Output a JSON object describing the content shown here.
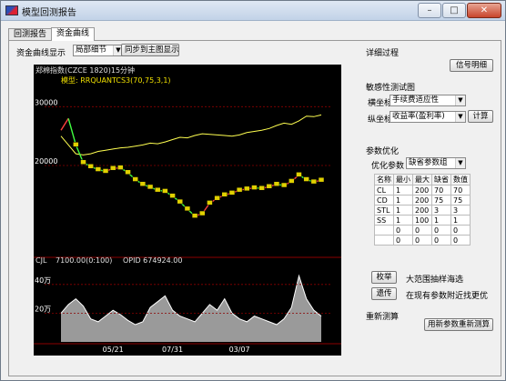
{
  "window": {
    "title": "模型回测报告"
  },
  "tabs": [
    {
      "label": "回测报告"
    },
    {
      "label": "资金曲线"
    }
  ],
  "toolbar": {
    "display_label": "资金曲线显示",
    "display_mode": "局部细节",
    "sync_button": "同步到主图显示"
  },
  "chart": {
    "header": "郑棉指数(CZCE 1820)15分钟",
    "model_label": "模型: RRQUANTCS3(70,75,3,1)",
    "y_ticks": [
      "30000",
      "20000"
    ],
    "volume_header_name": "CJL",
    "volume_header_value": "7100.00(0:100)",
    "volume_header_opid": "OPID 674924.00",
    "volume_ticks": [
      "40万",
      "20万"
    ],
    "x_ticks": [
      "05/21",
      "07/31",
      "03/07"
    ],
    "colors": {
      "equity": "#ffff50",
      "price_up": "#ff4040",
      "price_down": "#40ff40",
      "marker": "#e0d000",
      "volume": "#ffffff",
      "grid": "#8b0000"
    }
  },
  "chart_data": {
    "type": "line",
    "title": "郑棉指数(CZCE 1820)15分钟",
    "series": [
      {
        "name": "资金曲线",
        "values": [
          25000,
          23500,
          22000,
          21800,
          22000,
          22400,
          22600,
          22800,
          23000,
          23100,
          23300,
          23500,
          23800,
          23700,
          24000,
          24400,
          24800,
          24700,
          25100,
          25400,
          25300,
          25200,
          25100,
          25000,
          25200,
          25600,
          25800,
          26000,
          26300,
          26800,
          27200,
          27000,
          27600,
          28400,
          28300,
          28600
        ]
      },
      {
        "name": "价格",
        "values": [
          26000,
          28000,
          23500,
          20500,
          19800,
          19300,
          19000,
          19500,
          19600,
          18800,
          17600,
          16800,
          16300,
          15800,
          15600,
          14800,
          13800,
          12600,
          11400,
          11800,
          13600,
          14400,
          15000,
          15300,
          15800,
          16000,
          16200,
          16100,
          16400,
          16800,
          16600,
          17300,
          18400,
          17600,
          17200,
          17500
        ]
      }
    ],
    "ylim": [
      5000,
      35000
    ],
    "volume": [
      20,
      26,
      30,
      25,
      16,
      14,
      18,
      22,
      19,
      15,
      12,
      14,
      24,
      28,
      32,
      22,
      18,
      16,
      14,
      20,
      26,
      22,
      30,
      20,
      16,
      14,
      18,
      16,
      14,
      12,
      16,
      24,
      46,
      30,
      22,
      18
    ],
    "volume_unit": "万",
    "x_labels": [
      "05/21",
      "07/31",
      "03/07"
    ]
  },
  "right": {
    "details_title": "详细过程",
    "signal_button": "信号明细",
    "sensitivity_title": "敏感性测试图",
    "x_axis_label": "横坐标",
    "x_axis_value": "手续费适应性",
    "y_axis_label": "纵坐标",
    "y_axis_value": "收益率(盈利率)",
    "calc_button": "计算",
    "optimize_title": "参数优化",
    "optimize_label": "优化参数",
    "optimize_value": "缺省参数组",
    "table_headers": [
      "名称",
      "最小",
      "最大",
      "缺省",
      "数值"
    ],
    "table_rows": [
      [
        "CL",
        "1",
        "200",
        "70",
        "70"
      ],
      [
        "CD",
        "1",
        "200",
        "75",
        "75"
      ],
      [
        "STL",
        "1",
        "200",
        "3",
        "3"
      ],
      [
        "SS",
        "1",
        "100",
        "1",
        "1"
      ],
      [
        "",
        "0",
        "0",
        "0",
        "0"
      ],
      [
        "",
        "0",
        "0",
        "0",
        "0"
      ]
    ],
    "exhaust_button": "枚举",
    "exhaust_desc": "大范围抽样海选",
    "genetic_button": "遗传",
    "genetic_desc": "在现有参数附近找更优",
    "retest_title": "重新测算",
    "retest_button": "用新参数重新测算"
  }
}
